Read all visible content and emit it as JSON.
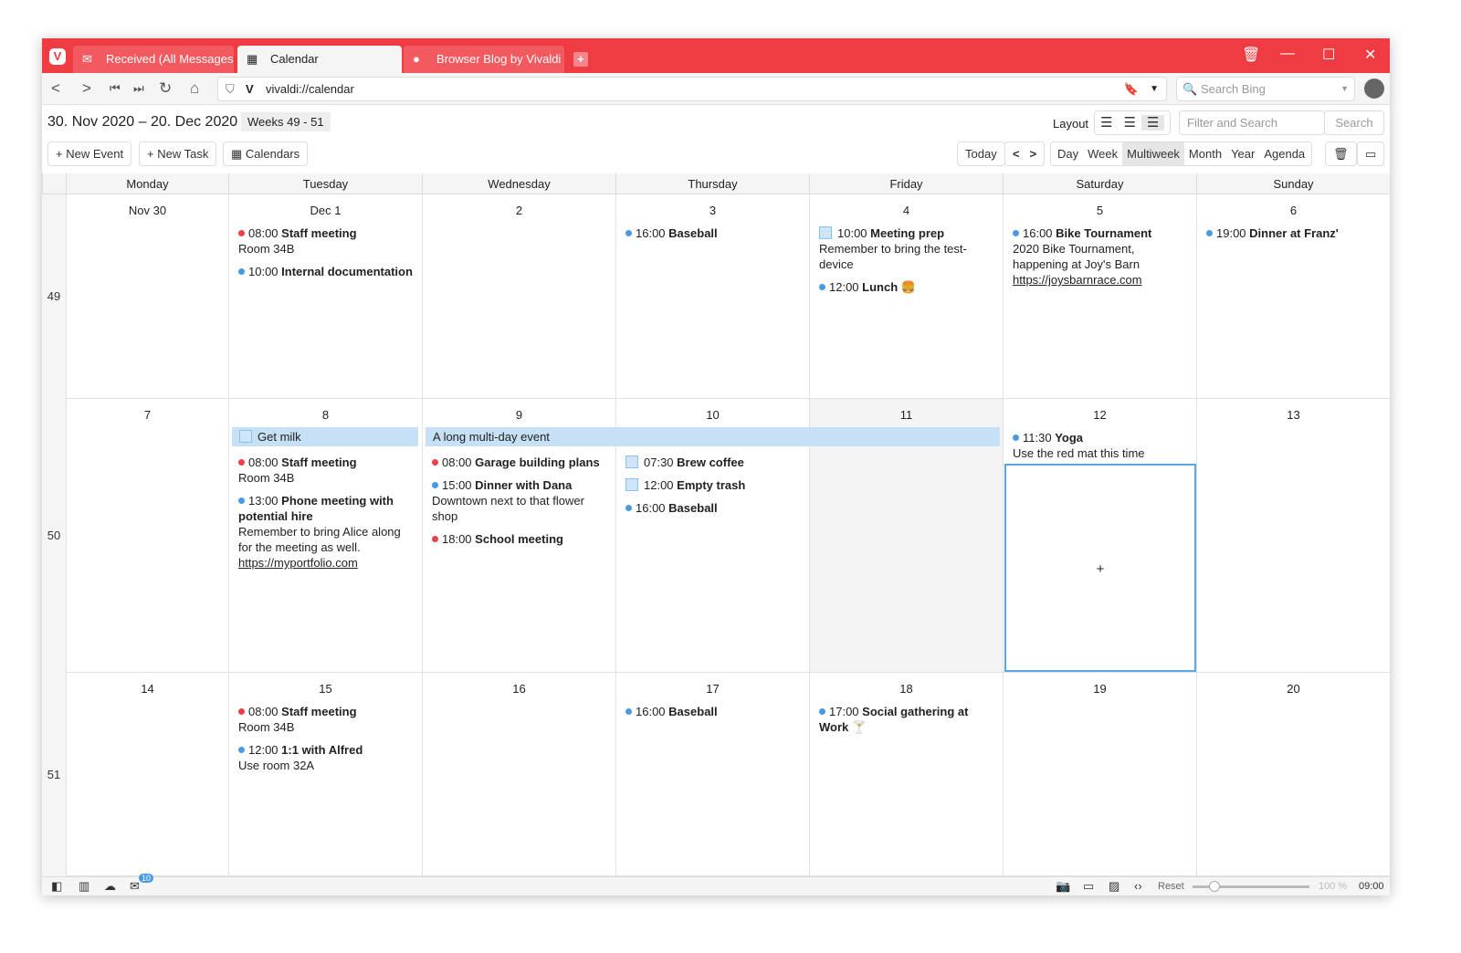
{
  "browser": {
    "tabs": [
      {
        "label": "Received (All Messages)",
        "icon": "mail-icon"
      },
      {
        "label": "Calendar",
        "icon": "calendar-icon"
      },
      {
        "label": "Browser Blog by Vivaldi - N",
        "icon": "vivaldi-icon"
      }
    ],
    "url": "vivaldi://calendar",
    "search_placeholder": "Search Bing",
    "brand_color": "#ef3b42"
  },
  "header": {
    "date_range": "30. Nov 2020 – 20. Dec 2020",
    "weeks": "Weeks 49 - 51",
    "new_event": "+ New Event",
    "new_task": "+ New Task",
    "calendars": "Calendars",
    "layout_label": "Layout",
    "filter_placeholder": "Filter and Search",
    "search_button": "Search",
    "today": "Today",
    "views": [
      "Day",
      "Week",
      "Multiweek",
      "Month",
      "Year",
      "Agenda"
    ],
    "active_view": "Multiweek"
  },
  "days": [
    "Monday",
    "Tuesday",
    "Wednesday",
    "Thursday",
    "Friday",
    "Saturday",
    "Sunday"
  ],
  "weeks": [
    {
      "number": "49",
      "dates": [
        "Nov 30",
        "Dec  1",
        "2",
        "3",
        "4",
        "5",
        "6"
      ],
      "events": [
        [],
        [
          {
            "color": "red",
            "time": "08:00",
            "title": "Staff meeting",
            "note": "Room 34B"
          },
          {
            "color": "blue",
            "time": "10:00",
            "title": "Internal documentation"
          }
        ],
        [],
        [
          {
            "color": "blue",
            "time": "16:00",
            "title": "Baseball"
          }
        ],
        [
          {
            "task": true,
            "time": "10:00",
            "title": "Meeting prep",
            "note": "Remember to bring the test-device"
          },
          {
            "color": "blue",
            "time": "12:00",
            "title": "Lunch 🍔"
          }
        ],
        [
          {
            "color": "blue",
            "time": "16:00",
            "title": "Bike Tournament",
            "note": "2020 Bike Tournament, happening at Joy's Barn",
            "link": "https://joysbarnrace.com"
          }
        ],
        [
          {
            "color": "blue",
            "time": "19:00",
            "title": "Dinner at Franz'"
          }
        ]
      ]
    },
    {
      "number": "50",
      "dates": [
        "7",
        "8",
        "9",
        "10",
        "11",
        "12",
        "13"
      ],
      "multiday": {
        "title": "A long multi-day event"
      },
      "task_bar": {
        "title": "Get milk"
      },
      "events": [
        [],
        [
          {
            "color": "red",
            "time": "08:00",
            "title": "Staff meeting",
            "note": "Room 34B"
          },
          {
            "color": "blue",
            "time": "13:00",
            "title": "Phone meeting with potential hire",
            "note": "Remember to bring Alice along for the meeting as well.",
            "link": "https://myportfolio.com"
          }
        ],
        [
          {
            "color": "red",
            "time": "08:00",
            "title": "Garage building plans"
          },
          {
            "color": "blue",
            "time": "15:00",
            "title": "Dinner with Dana",
            "note": "Downtown next to that flower shop"
          },
          {
            "color": "red",
            "time": "18:00",
            "title": "School meeting"
          }
        ],
        [
          {
            "task": true,
            "time": "07:30",
            "title": "Brew coffee"
          },
          {
            "task": true,
            "time": "12:00",
            "title": "Empty trash"
          },
          {
            "color": "blue",
            "time": "16:00",
            "title": "Baseball"
          }
        ],
        [],
        [
          {
            "color": "blue",
            "time": "11:30",
            "title": "Yoga",
            "note": "Use the red mat this time"
          }
        ],
        []
      ]
    },
    {
      "number": "51",
      "dates": [
        "14",
        "15",
        "16",
        "17",
        "18",
        "19",
        "20"
      ],
      "events": [
        [],
        [
          {
            "color": "red",
            "time": "08:00",
            "title": "Staff meeting",
            "note": "Room 34B"
          },
          {
            "color": "blue",
            "time": "12:00",
            "title": "1:1 with Alfred",
            "note": "Use room 32A"
          }
        ],
        [],
        [
          {
            "color": "blue",
            "time": "16:00",
            "title": "Baseball"
          }
        ],
        [
          {
            "color": "blue",
            "time": "17:00",
            "title": "Social gathering at Work 🍸"
          }
        ],
        [],
        []
      ]
    }
  ],
  "add_symbol": "+",
  "status": {
    "mail_badge": "10",
    "reset": "Reset",
    "zoom": "100 %",
    "clock": "09:00"
  },
  "colors": {
    "red": "#e8414a",
    "blue": "#4a9ae0"
  }
}
